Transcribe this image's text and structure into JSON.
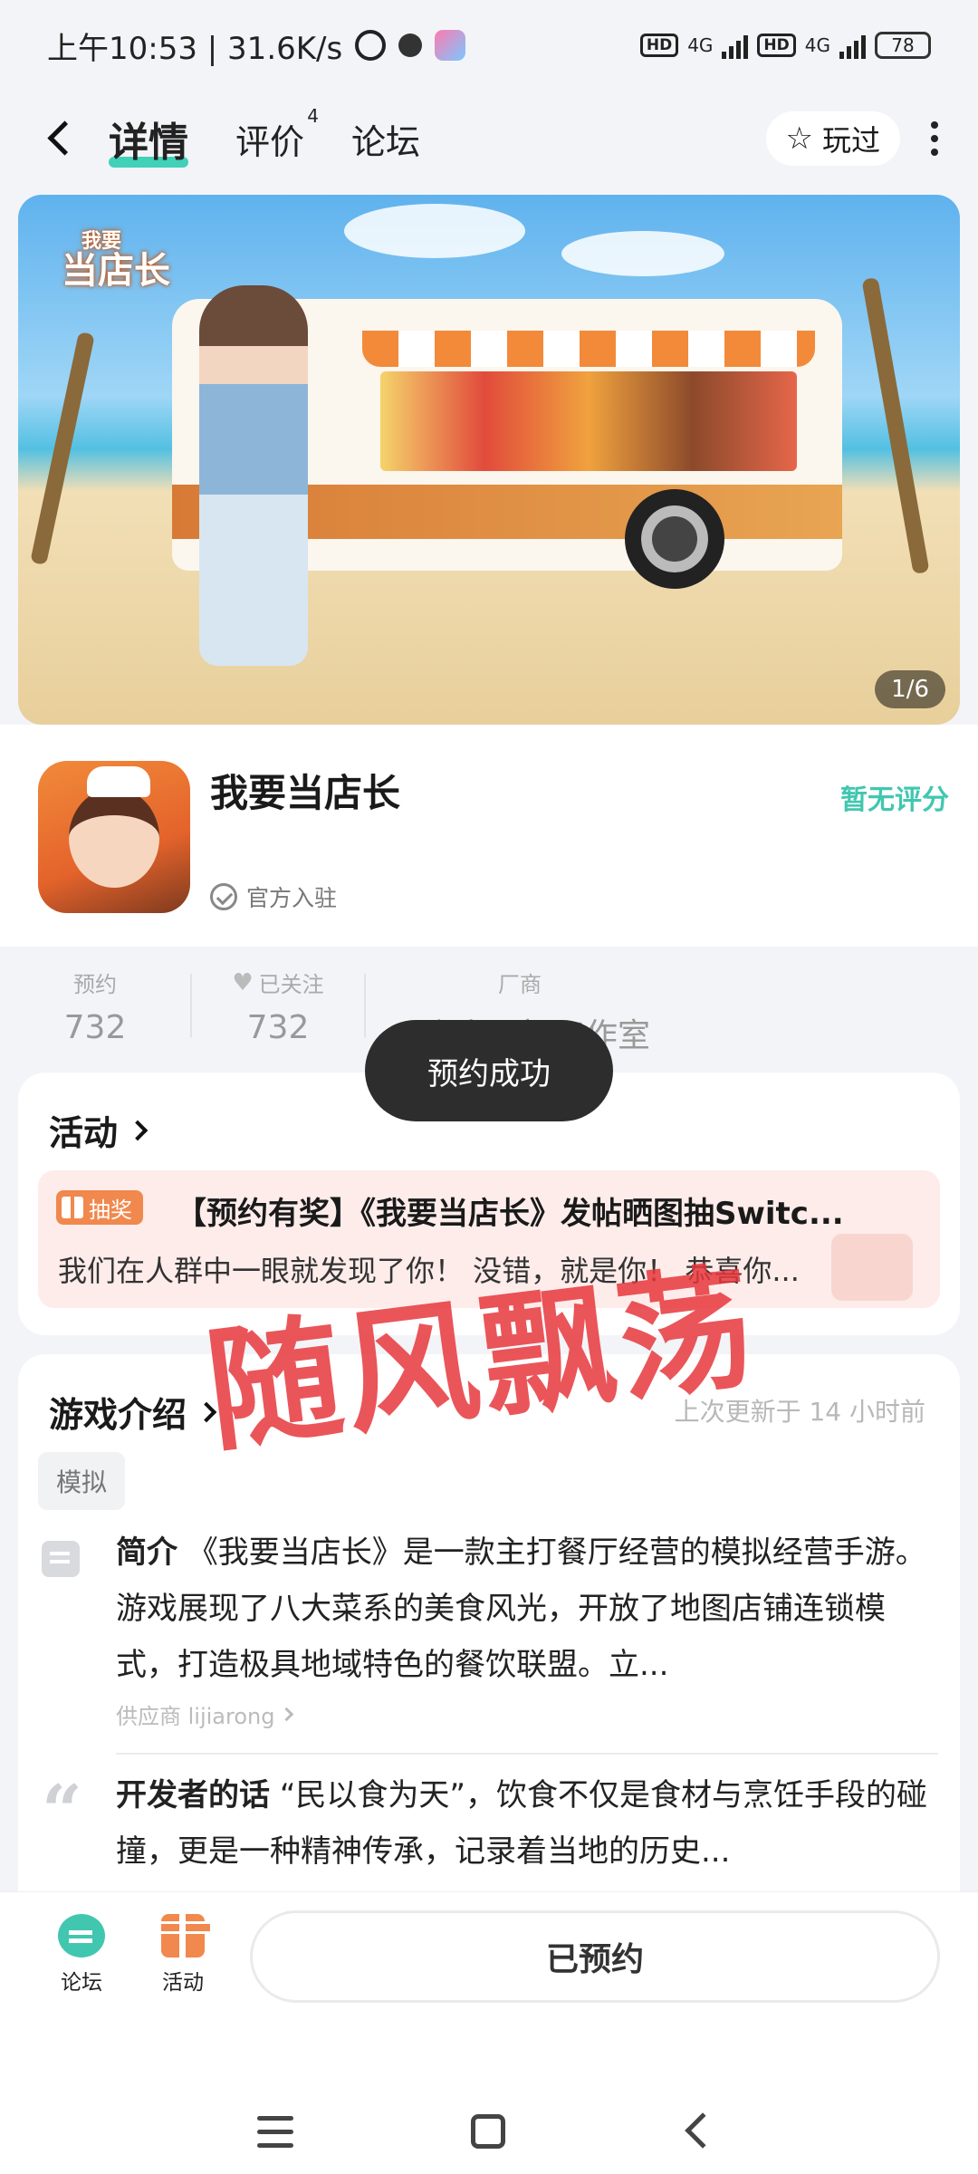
{
  "status_bar": {
    "time_speed": "上午10:53 | 31.6K/s",
    "network1": "4G",
    "network2": "4G",
    "hd": "HD",
    "battery": "78"
  },
  "nav": {
    "tabs": [
      {
        "label": "详情",
        "active": true
      },
      {
        "label": "评价",
        "badge": "4"
      },
      {
        "label": "论坛"
      }
    ],
    "played_label": "玩过"
  },
  "banner": {
    "logo_line1": "我要",
    "logo_line2": "当店长",
    "counter": "1/6"
  },
  "game": {
    "name": "我要当店长",
    "official": "官方入驻",
    "rating": "暂无评分"
  },
  "stats": [
    {
      "label": "预约",
      "value": "732"
    },
    {
      "label": "已关注",
      "value": "732"
    },
    {
      "label": "厂商",
      "value": "一个小目标工作室"
    }
  ],
  "toast": "预约成功",
  "activity": {
    "title": "活动",
    "badge": "抽奖",
    "headline": "【预约有奖】《我要当店长》发帖晒图抽Switc...",
    "desc": "我们在人群中一眼就发现了你！ 没错，就是你！ 恭喜你..."
  },
  "intro": {
    "title": "游戏介绍",
    "updated": "上次更新于 14 小时前",
    "tag": "模拟",
    "summary_label": "简介",
    "summary": "《我要当店长》是一款主打餐厅经营的模拟经营手游。 游戏展现了八大菜系的美食风光，开放了地图店铺连锁模式，打造极具地域特色的餐饮联盟。立...",
    "supplier": "供应商 lijiarong",
    "dev_label": "开发者的话",
    "dev_words": "“民以食为天”，饮食不仅是食材与烹饪手段的碰撞，更是一种精神传承，记录着当地的历史..."
  },
  "watermark": "随风飘荡",
  "bottom": {
    "forum": "论坛",
    "activity": "活动",
    "reserved": "已预约"
  },
  "colors": {
    "accent": "#41c7b0",
    "activity_orange": "#f1884d",
    "watermark_red": "#e6373c"
  }
}
